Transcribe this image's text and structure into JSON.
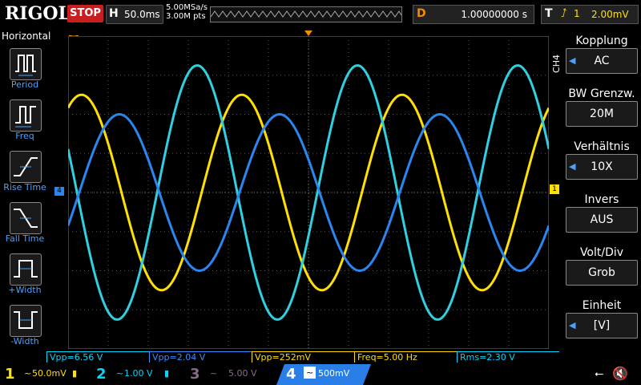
{
  "brand": "RIGOL",
  "run_state": "STOP",
  "horizontal": {
    "key": "H",
    "timebase": "50.0ms"
  },
  "acquisition": {
    "sample_rate": "5.00MSa/s",
    "memory_depth": "3.00M pts"
  },
  "delay": {
    "key": "D",
    "value": "1.00000000 s"
  },
  "trigger": {
    "key": "T",
    "edge_icon": "rising-edge-icon",
    "source": "1",
    "level": "2.00mV"
  },
  "left_menu": {
    "title": "Horizontal",
    "items": [
      {
        "label": "Period",
        "icon": "period-icon"
      },
      {
        "label": "Freq",
        "icon": "freq-icon"
      },
      {
        "label": "Rise Time",
        "icon": "rise-time-icon"
      },
      {
        "label": "Fall Time",
        "icon": "fall-time-icon"
      },
      {
        "label": "+Width",
        "icon": "pos-width-icon"
      },
      {
        "label": "-Width",
        "icon": "neg-width-icon"
      }
    ]
  },
  "channel_menu": {
    "channel_tag": "CH4",
    "groups": [
      {
        "title": "Kopplung",
        "value": "AC",
        "has_arrow": true
      },
      {
        "title": "BW Grenzw.",
        "value": "20M",
        "has_arrow": false
      },
      {
        "title": "Verhältnis",
        "value": "10X",
        "has_arrow": true
      },
      {
        "title": "Invers",
        "value": "AUS",
        "has_arrow": false
      },
      {
        "title": "Volt/Div",
        "value": "Grob",
        "has_arrow": false
      },
      {
        "title": "Einheit",
        "value": "[V]",
        "has_arrow": true
      }
    ]
  },
  "markers": {
    "ch1": "1",
    "ch4": "4",
    "trigger": "T"
  },
  "measurements": [
    {
      "label": "Vpp=6.56 V",
      "color": "#00d8ff"
    },
    {
      "label": "Vpp=2.04 V",
      "color": "#3a8dff"
    },
    {
      "label": "Vpp=252mV",
      "color": "#ffe000"
    },
    {
      "label": "Freq=5.00 Hz",
      "color": "#ffe000"
    },
    {
      "label": "Rms=2.30 V",
      "color": "#00d8ff"
    }
  ],
  "channels": [
    {
      "num": "1",
      "coupling_icon": "~",
      "scale": "50.0mV",
      "color": "#ffe000",
      "active": true
    },
    {
      "num": "2",
      "coupling_icon": "~",
      "scale": "1.00 V",
      "color": "#00d8ff",
      "active": true
    },
    {
      "num": "3",
      "coupling_icon": "~",
      "scale": "5.00 V",
      "color": "#8a6a86",
      "active": false
    },
    {
      "num": "4",
      "coupling_icon": "~",
      "scale": "500mV",
      "color": "#3a8dff",
      "active": true
    }
  ],
  "waveforms": [
    {
      "channel": "1",
      "color": "#ffe000",
      "amplitude_div": 2.5,
      "offset_div": 0.0,
      "period_div": 4.0,
      "phase_deg": 60
    },
    {
      "channel": "2",
      "color": "#30d0e0",
      "amplitude_div": 3.25,
      "offset_div": 0.0,
      "period_div": 4.0,
      "phase_deg": 160
    },
    {
      "channel": "4",
      "color": "#2a86f0",
      "amplitude_div": 2.0,
      "offset_div": 0.0,
      "period_div": 4.0,
      "phase_deg": 335
    }
  ]
}
